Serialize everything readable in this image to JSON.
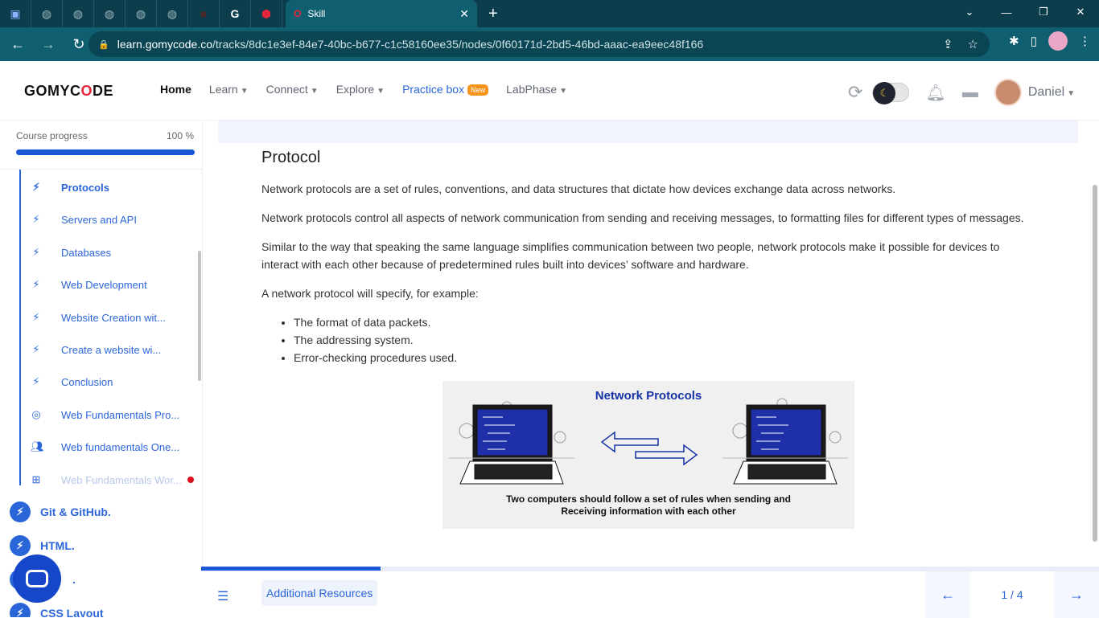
{
  "browser": {
    "tab_title": "Skill",
    "url_domain": "learn.gomycode.co",
    "url_path": "/tracks/8dc1e3ef-84e7-40bc-b677-c1c58160ee35/nodes/0f60171d-2bd5-46bd-aaac-ea9eec48f166"
  },
  "header": {
    "logo": "GOMYCODE",
    "nav": {
      "home": "Home",
      "learn": "Learn",
      "connect": "Connect",
      "explore": "Explore",
      "practice": "Practice box",
      "practice_badge": "New",
      "labphase": "LabPhase"
    },
    "user_name": "Daniel"
  },
  "sidebar": {
    "progress_label": "Course progress",
    "progress_pct": "100 %",
    "progress_value": 1.0,
    "lessons": [
      {
        "label": "Protocols",
        "icon": "bolt-icon"
      },
      {
        "label": "Servers and API",
        "icon": "bolt-icon"
      },
      {
        "label": "Databases",
        "icon": "bolt-icon"
      },
      {
        "label": "Web Development",
        "icon": "bolt-icon"
      },
      {
        "label": "Website Creation wit...",
        "icon": "bolt-icon"
      },
      {
        "label": "Create a website wi...",
        "icon": "bolt-icon"
      },
      {
        "label": "Conclusion",
        "icon": "bolt-icon"
      },
      {
        "label": "Web Fundamentals Pro...",
        "icon": "target-icon"
      },
      {
        "label": "Web fundamentals One...",
        "icon": "people-icon"
      },
      {
        "label": "Web Fundamentals Wor...",
        "icon": "workshop-icon"
      }
    ],
    "chapters": [
      {
        "label": "Git & GitHub."
      },
      {
        "label": "HTML."
      },
      {
        "label": "."
      },
      {
        "label": "CSS Layout"
      }
    ]
  },
  "content": {
    "title": "Protocol",
    "paragraphs": [
      "Network protocols are a set of rules, conventions, and data structures that dictate how devices exchange data across networks.",
      "Network protocols control all aspects of network communication from sending and receiving messages, to formatting files for different types of messages.",
      "Similar to the way that speaking the same language simplifies communication between two people, network protocols make it possible for devices to interact with each other because of predetermined rules built into devices’ software and hardware.",
      "A network protocol will specify, for example:"
    ],
    "bullets": [
      "The format of data packets.",
      "The addressing system.",
      "Error-checking procedures used."
    ],
    "diagram": {
      "title": "Network Protocols",
      "caption_line1": "Two computers should follow a set of rules when sending and",
      "caption_line2": "Receiving information with each other"
    }
  },
  "bottom": {
    "additional": "Additional Resources",
    "pager": "1 / 4",
    "progress_value": 0.2
  },
  "colors": {
    "accent": "#2b66d9",
    "chrome": "#0f5f70",
    "badge": "#f7941d",
    "alert_dot": "#e00b1c"
  }
}
